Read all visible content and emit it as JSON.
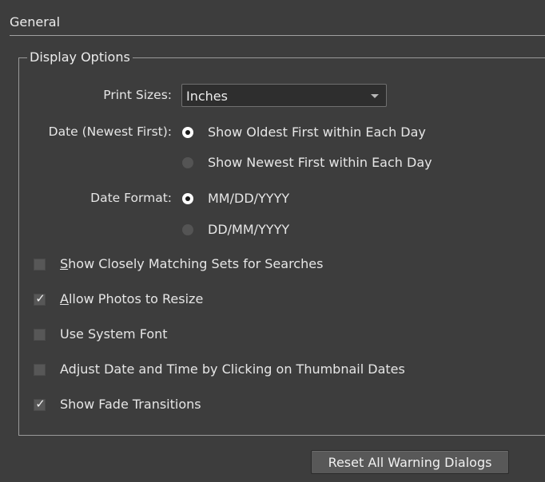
{
  "section": {
    "title": "General"
  },
  "display_options": {
    "legend": "Display Options",
    "print_sizes": {
      "label": "Print Sizes:",
      "selected": "Inches"
    },
    "date_order": {
      "label": "Date (Newest First):",
      "options": [
        {
          "label": "Show Oldest First within Each Day",
          "checked": true
        },
        {
          "label": "Show Newest First within Each Day",
          "checked": false
        }
      ]
    },
    "date_format": {
      "label": "Date Format:",
      "options": [
        {
          "label": "MM/DD/YYYY",
          "checked": true
        },
        {
          "label": "DD/MM/YYYY",
          "checked": false
        }
      ]
    },
    "checkboxes": [
      {
        "first": "S",
        "rest": "how Closely Matching Sets for Searches",
        "checked": false
      },
      {
        "first": "A",
        "rest": "llow Photos to Resize",
        "checked": true
      },
      {
        "first": "",
        "rest": "Use System Font",
        "checked": false
      },
      {
        "first": "",
        "rest": "Adjust Date and Time by Clicking on Thumbnail Dates",
        "checked": false
      },
      {
        "first": "",
        "rest": "Show Fade Transitions",
        "checked": true
      }
    ]
  },
  "reset_button": {
    "label": "Reset All Warning Dialogs"
  },
  "icons": {
    "dropdown_arrow": "triangle-down",
    "check_mark": "check"
  }
}
